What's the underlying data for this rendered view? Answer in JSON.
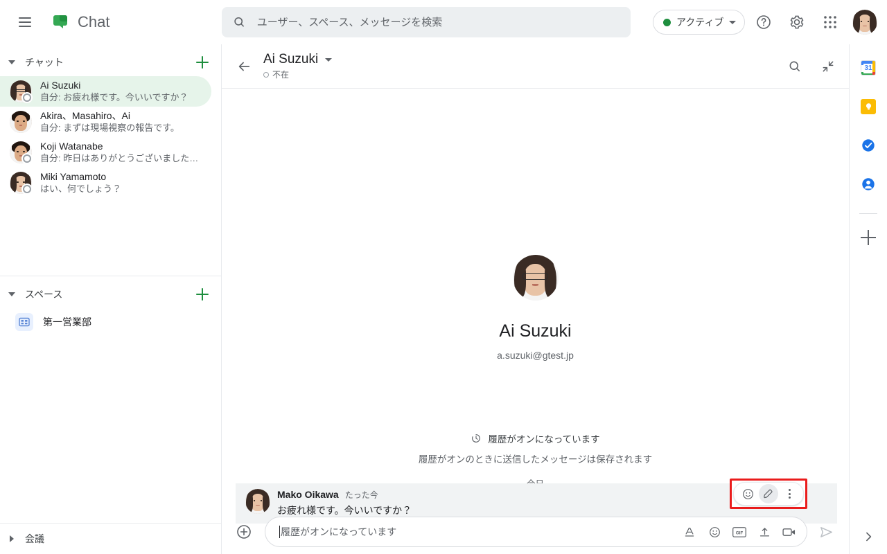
{
  "app": {
    "brand_title": "Chat",
    "menu_icon": "hamburger-icon",
    "logo_icon": "google-chat-logo"
  },
  "search": {
    "placeholder": "ユーザー、スペース、メッセージを検索",
    "value": "",
    "icon": "search-icon"
  },
  "status": {
    "label": "アクティブ",
    "dot_color": "#1e8e3e",
    "caret": "chevron-down-icon"
  },
  "topbar_icons": {
    "help": "help-icon",
    "settings": "gear-icon",
    "apps": "apps-grid-icon",
    "account": "account-avatar"
  },
  "sidebar": {
    "chat_section": {
      "title": "チャット",
      "expanded": true,
      "add_label": "+"
    },
    "chats": [
      {
        "name": "Ai Suzuki",
        "snippet": "自分: お疲れ様です。今いいですか？",
        "selected": true,
        "presence": "away"
      },
      {
        "name": "Akira、Masahiro、Ai",
        "snippet": "自分: まずは現場視察の報告です。",
        "selected": false,
        "presence": "none"
      },
      {
        "name": "Koji Watanabe",
        "snippet": "自分: 昨日はありがとうございました…",
        "selected": false,
        "presence": "away"
      },
      {
        "name": "Miki Yamamoto",
        "snippet": "はい、何でしょう？",
        "selected": false,
        "presence": "away"
      }
    ],
    "spaces_section": {
      "title": "スペース",
      "expanded": true,
      "add_label": "+"
    },
    "spaces": [
      {
        "name": "第一営業部",
        "icon": "space-icon"
      }
    ],
    "meetings_section": {
      "title": "会議",
      "expanded": false
    }
  },
  "conversation": {
    "back_icon": "back-arrow-icon",
    "title": "Ai Suzuki",
    "title_caret": "chevron-down-icon",
    "status": "不在",
    "search_icon": "search-icon",
    "collapse_icon": "collapse-icon",
    "profile": {
      "name": "Ai Suzuki",
      "email": "a.suzuki@gtest.jp"
    },
    "history": {
      "icon": "history-clock-icon",
      "title": "履歴がオンになっています",
      "subtitle": "履歴がオンのときに送信したメッセージは保存されます"
    },
    "day_divider": "今日",
    "messages": [
      {
        "author": "Mako Oikawa",
        "time": "たった今",
        "text": "お疲れ様です。今いいですか？",
        "hovered": true
      }
    ],
    "hover_actions": {
      "react": "emoji-reaction-icon",
      "edit": "pencil-edit-icon",
      "more": "more-options-icon",
      "highlight_color": "#ea1c1c",
      "active": "edit"
    }
  },
  "composer": {
    "plus_icon": "add-attachment-icon",
    "placeholder": "履歴がオンになっています",
    "value": "",
    "icons": {
      "format": "format-text-icon",
      "emoji": "emoji-icon",
      "gif": "gif-icon",
      "upload": "upload-icon",
      "video": "video-icon",
      "send": "send-icon"
    },
    "gif_label": "GIF"
  },
  "right_rail": {
    "items": [
      {
        "icon": "google-calendar-icon",
        "label": "31"
      },
      {
        "icon": "google-keep-icon",
        "label": ""
      },
      {
        "icon": "google-tasks-icon",
        "label": ""
      },
      {
        "icon": "google-contacts-icon",
        "label": ""
      }
    ],
    "add_icon": "add-app-icon",
    "expand_icon": "chevron-right-icon"
  }
}
